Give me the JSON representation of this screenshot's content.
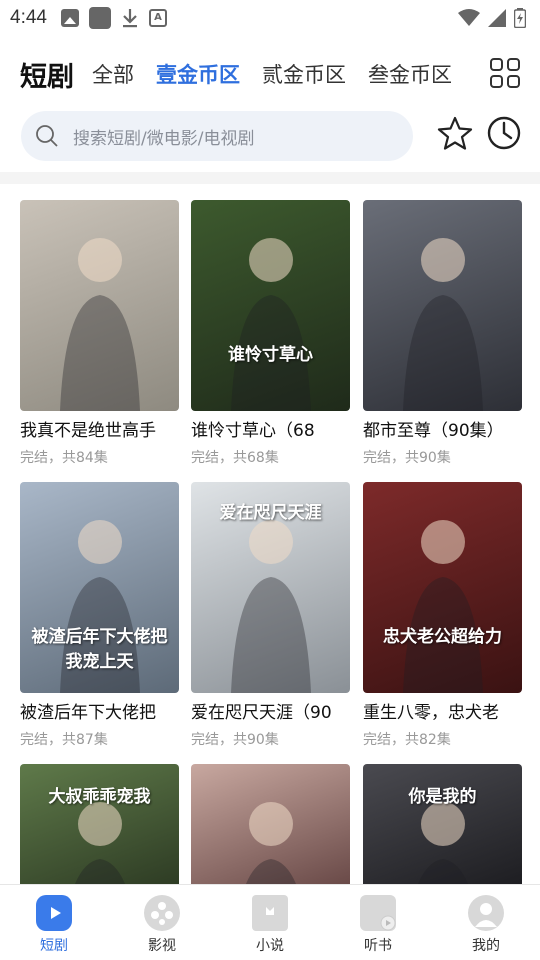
{
  "status_bar": {
    "time": "4:44",
    "left_icons": [
      "image-icon",
      "app-icon",
      "download-icon",
      "a-icon"
    ],
    "right_icons": [
      "wifi-icon",
      "signal-icon",
      "battery-icon"
    ]
  },
  "top_nav": {
    "brand": "短剧",
    "tabs": [
      {
        "label": "全部",
        "active": false
      },
      {
        "label": "壹金币区",
        "active": true
      },
      {
        "label": "贰金币区",
        "active": false
      },
      {
        "label": "叁金币区",
        "active": false
      }
    ],
    "accent_color": "#2f6fde"
  },
  "search": {
    "placeholder": "搜索短剧/微电影/电视剧"
  },
  "cards": [
    {
      "title": "我真不是绝世高手",
      "meta": "完结，共84集",
      "poster_colors": [
        "#c9c2b8",
        "#8e8a80"
      ],
      "overlay": ""
    },
    {
      "title": "谁怜寸草心（68",
      "meta": "完结，共68集",
      "poster_colors": [
        "#3d5a2e",
        "#1f2a1a"
      ],
      "overlay": "谁怜寸草心"
    },
    {
      "title": "都市至尊（90集）",
      "meta": "完结，共90集",
      "poster_colors": [
        "#6a6e78",
        "#2d2f36"
      ],
      "overlay": ""
    },
    {
      "title": "被渣后年下大佬把",
      "meta": "完结，共87集",
      "poster_colors": [
        "#a9b7c8",
        "#5d6a78"
      ],
      "overlay": "被渣后年下大佬把我宠上天"
    },
    {
      "title": "爱在咫尺天涯（90",
      "meta": "完结，共90集",
      "poster_colors": [
        "#dfe3e6",
        "#8a9096"
      ],
      "overlay": "爱在咫尺天涯"
    },
    {
      "title": "重生八零，忠犬老",
      "meta": "完结，共82集",
      "poster_colors": [
        "#7d2a2a",
        "#3a1212"
      ],
      "overlay": "忠犬老公超给力"
    },
    {
      "title": "",
      "meta": "",
      "poster_colors": [
        "#5f7a4a",
        "#2e3c24"
      ],
      "overlay": "大叔乖乖宠我"
    },
    {
      "title": "",
      "meta": "",
      "poster_colors": [
        "#c8a8a0",
        "#6a4a48"
      ],
      "overlay": ""
    },
    {
      "title": "",
      "meta": "",
      "poster_colors": [
        "#4a4a50",
        "#1e1e22"
      ],
      "overlay": "你是我的"
    }
  ],
  "bottom_nav": [
    {
      "label": "短剧",
      "icon": "tv-icon",
      "active": true
    },
    {
      "label": "影视",
      "icon": "film-reel-icon",
      "active": false
    },
    {
      "label": "小说",
      "icon": "book-icon",
      "active": false
    },
    {
      "label": "听书",
      "icon": "audiobook-icon",
      "active": false
    },
    {
      "label": "我的",
      "icon": "profile-icon",
      "active": false
    }
  ]
}
